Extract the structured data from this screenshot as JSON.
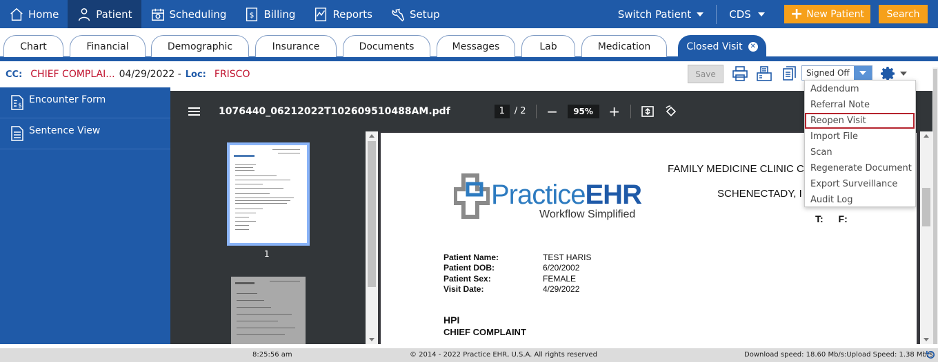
{
  "nav": {
    "items": [
      {
        "label": "Home",
        "icon": "home-icon"
      },
      {
        "label": "Patient",
        "icon": "user-icon"
      },
      {
        "label": "Scheduling",
        "icon": "calendar-icon"
      },
      {
        "label": "Billing",
        "icon": "dollar-icon"
      },
      {
        "label": "Reports",
        "icon": "chart-icon"
      },
      {
        "label": "Setup",
        "icon": "wrench-icon"
      }
    ],
    "switch_patient": "Switch Patient",
    "cds": "CDS",
    "new_patient": "New Patient",
    "search": "Search"
  },
  "tabs": [
    "Chart",
    "Financial",
    "Demographic",
    "Insurance",
    "Documents",
    "Messages",
    "Lab",
    "Medication",
    "Closed Visit"
  ],
  "infobar": {
    "cc_label": "CC:",
    "cc_value": "CHIEF COMPLAI...",
    "date": "04/29/2022 -",
    "loc_label": "Loc:",
    "loc_value": "FRISCO",
    "save": "Save",
    "status_select": "Signed Off"
  },
  "sidebar": {
    "items": [
      {
        "label": "Encounter Form"
      },
      {
        "label": "Sentence View"
      }
    ]
  },
  "pdf": {
    "filename": "1076440_06212022T102609510488AM.pdf",
    "page_current": "1",
    "page_total": "/ 2",
    "zoom": "95%",
    "thumb_label": "1",
    "clinic_name": "FAMILY MEDICINE CLINIC C",
    "clinic_city": "SCHENECTADY, I",
    "clinic_tf": "T: F:",
    "logo_main": "Practice",
    "logo_bold": "EHR",
    "logo_sub": "Workflow Simplified",
    "patient": [
      {
        "k": "Patient Name:",
        "v": "TEST HARIS"
      },
      {
        "k": "Patient DOB:",
        "v": "6/20/2002"
      },
      {
        "k": "Patient Sex:",
        "v": "FEMALE"
      },
      {
        "k": "Visit Date:",
        "v": "4/29/2022"
      }
    ],
    "hpi": "HPI",
    "chief_complaint": "CHIEF COMPLAINT"
  },
  "menu": {
    "items": [
      "Addendum",
      "Referral Note",
      "Reopen Visit",
      "Import File",
      "Scan",
      "Regenerate Document",
      "Export Surveillance",
      "Audit Log"
    ]
  },
  "status": {
    "time": "8:25:56 am",
    "copyright": "© 2014 - 2022 Practice EHR, U.S.A. All rights reserved",
    "speed": "Download speed: 18.60 Mb/s:Upload Speed: 1.38 Mb/s"
  },
  "colors": {
    "brand_blue": "#1f5aa8",
    "accent_orange": "#f6a01a",
    "alert_red": "#c0102c"
  }
}
